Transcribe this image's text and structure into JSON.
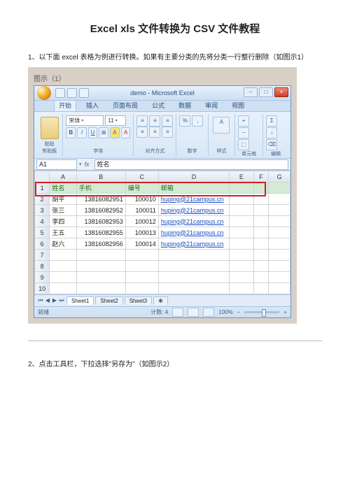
{
  "title": "Excel xls 文件转换为 CSV 文件教程",
  "step1": "1、以下面 excel 表格为例进行转换。如果有主要分类的先将分类一行整行删除（如图示1）",
  "step2": "2、点击工具栏，下拉选择\"另存为\"（如图示2）",
  "shot_caption": "图示（1）",
  "excel": {
    "window_title": "demo - Microsoft Excel",
    "tabs": [
      "开始",
      "插入",
      "页面布局",
      "公式",
      "数据",
      "审阅",
      "视图"
    ],
    "ribbon": {
      "paste": "粘贴",
      "clipboard": "剪贴板",
      "font_name": "宋体",
      "font_size": "11",
      "font_group": "字体",
      "align_group": "对齐方式",
      "number_group": "数字",
      "style_group": "样式",
      "cell_group": "单元格",
      "edit_group": "编辑"
    },
    "name_box": "A1",
    "formula_value": "姓名",
    "columns": [
      "A",
      "B",
      "C",
      "D",
      "E",
      "F",
      "G"
    ],
    "sheet_headers": [
      "姓名",
      "手机",
      "编号",
      "邮箱"
    ],
    "rows": [
      {
        "n": "2",
        "c": [
          "胡平",
          "13816082951",
          "100010",
          "huping@21campus.cn"
        ]
      },
      {
        "n": "3",
        "c": [
          "张三",
          "13816082952",
          "100011",
          "huping@21campus.cn"
        ]
      },
      {
        "n": "4",
        "c": [
          "李四",
          "13816082953",
          "100012",
          "huping@21campus.cn"
        ]
      },
      {
        "n": "5",
        "c": [
          "王五",
          "13816082955",
          "100013",
          "huping@21campus.cn"
        ]
      },
      {
        "n": "6",
        "c": [
          "赵六",
          "13816082956",
          "100014",
          "huping@21campus.cn"
        ]
      }
    ],
    "empty_rows": [
      "7",
      "8",
      "9",
      "10"
    ],
    "sheets": [
      "Sheet1",
      "Sheet2",
      "Sheet3"
    ],
    "status_ready": "就绪",
    "status_count": "计数: 4",
    "zoom": "100%"
  }
}
